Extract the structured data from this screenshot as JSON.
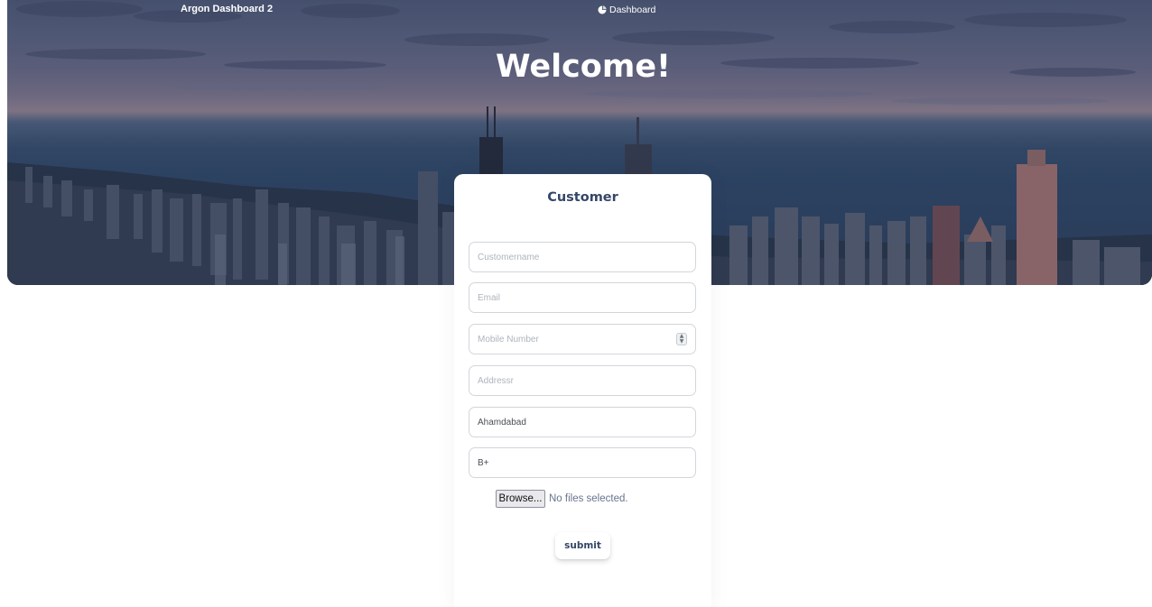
{
  "navbar": {
    "brand": "Argon Dashboard 2",
    "links": [
      {
        "label": "Dashboard",
        "icon": "pie-chart-icon"
      }
    ]
  },
  "hero": {
    "title": "Welcome!"
  },
  "form": {
    "title": "Customer",
    "fields": {
      "customer_name": {
        "placeholder": "Customername",
        "value": ""
      },
      "email": {
        "placeholder": "Email",
        "value": ""
      },
      "mobile": {
        "placeholder": "Mobile Number",
        "value": ""
      },
      "address": {
        "placeholder": "Addressr",
        "value": ""
      },
      "city": {
        "placeholder": "",
        "value": "Ahamdabad"
      },
      "blood_group": {
        "placeholder": "",
        "value": "B+"
      }
    },
    "file": {
      "button_label": "Browse...",
      "status": "No files selected."
    },
    "submit_label": "submit"
  },
  "colors": {
    "title_text": "#344767",
    "placeholder": "#adb5bd",
    "border": "#d2d6da"
  }
}
